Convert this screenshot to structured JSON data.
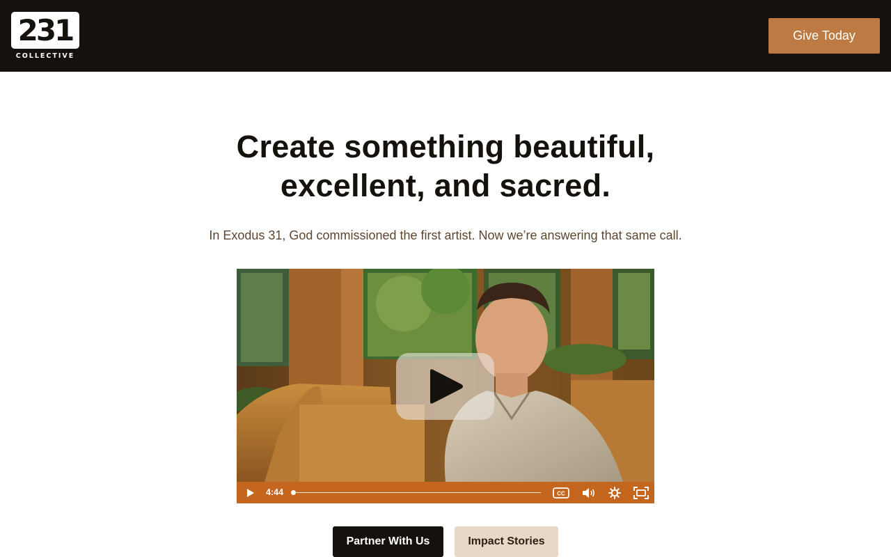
{
  "header": {
    "logo_number": "231",
    "logo_word": "COLLECTIVE",
    "give_button": "Give Today"
  },
  "hero": {
    "headline_line1": "Create something beautiful,",
    "headline_line2": "excellent, and sacred.",
    "subheadline": "In Exodus 31, God commissioned the first artist. Now we’re answering that same call."
  },
  "video": {
    "duration": "4:44",
    "progress_fraction": 0,
    "controls": [
      "play-icon",
      "captions-icon",
      "volume-icon",
      "settings-icon",
      "fullscreen-icon"
    ]
  },
  "actions": {
    "primary": "Partner With Us",
    "secondary": "Impact Stories"
  },
  "colors": {
    "header_bg": "#15110d",
    "accent": "#bd7a43",
    "player_bar": "#c4661d",
    "secondary_button": "#e9d8c6"
  }
}
